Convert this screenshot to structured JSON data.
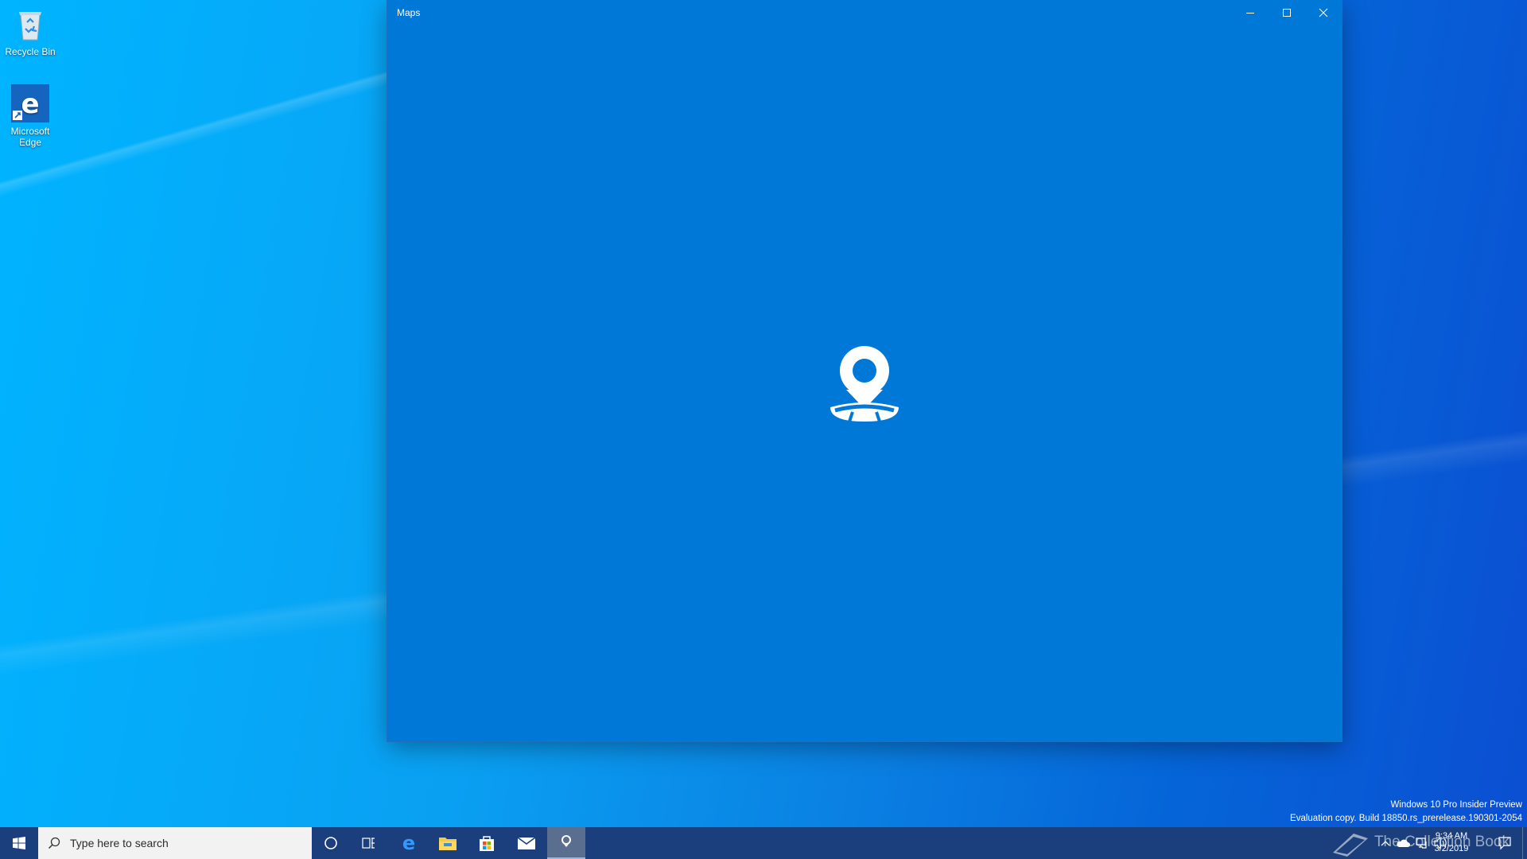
{
  "desktop": {
    "icons": [
      {
        "label": "Recycle Bin",
        "icon": "recycle-bin-icon"
      },
      {
        "label": "Microsoft Edge",
        "icon": "edge-icon"
      }
    ],
    "watermark": {
      "line1": "Windows 10 Pro Insider Preview",
      "line2": "Evaluation copy. Build 18850.rs_prerelease.190301-2054"
    },
    "brand_overlay": "The Collection Book"
  },
  "window": {
    "title": "Maps",
    "accent": "#0078d7",
    "controls": [
      "minimize-icon",
      "maximize-icon",
      "close-icon"
    ],
    "splash_icon": "maps-location-pin-icon"
  },
  "taskbar": {
    "search_placeholder": "Type here to search",
    "pinned": [
      "cortana-icon",
      "task-view-icon",
      "edge-icon",
      "file-explorer-icon",
      "store-icon",
      "mail-icon",
      "maps-icon"
    ],
    "clock": {
      "time": "9:34 AM",
      "date": "3/2/2019"
    },
    "tray_icons": [
      "chevron-up-icon",
      "onedrive-icon",
      "network-icon",
      "volume-icon",
      "action-center-icon"
    ]
  }
}
